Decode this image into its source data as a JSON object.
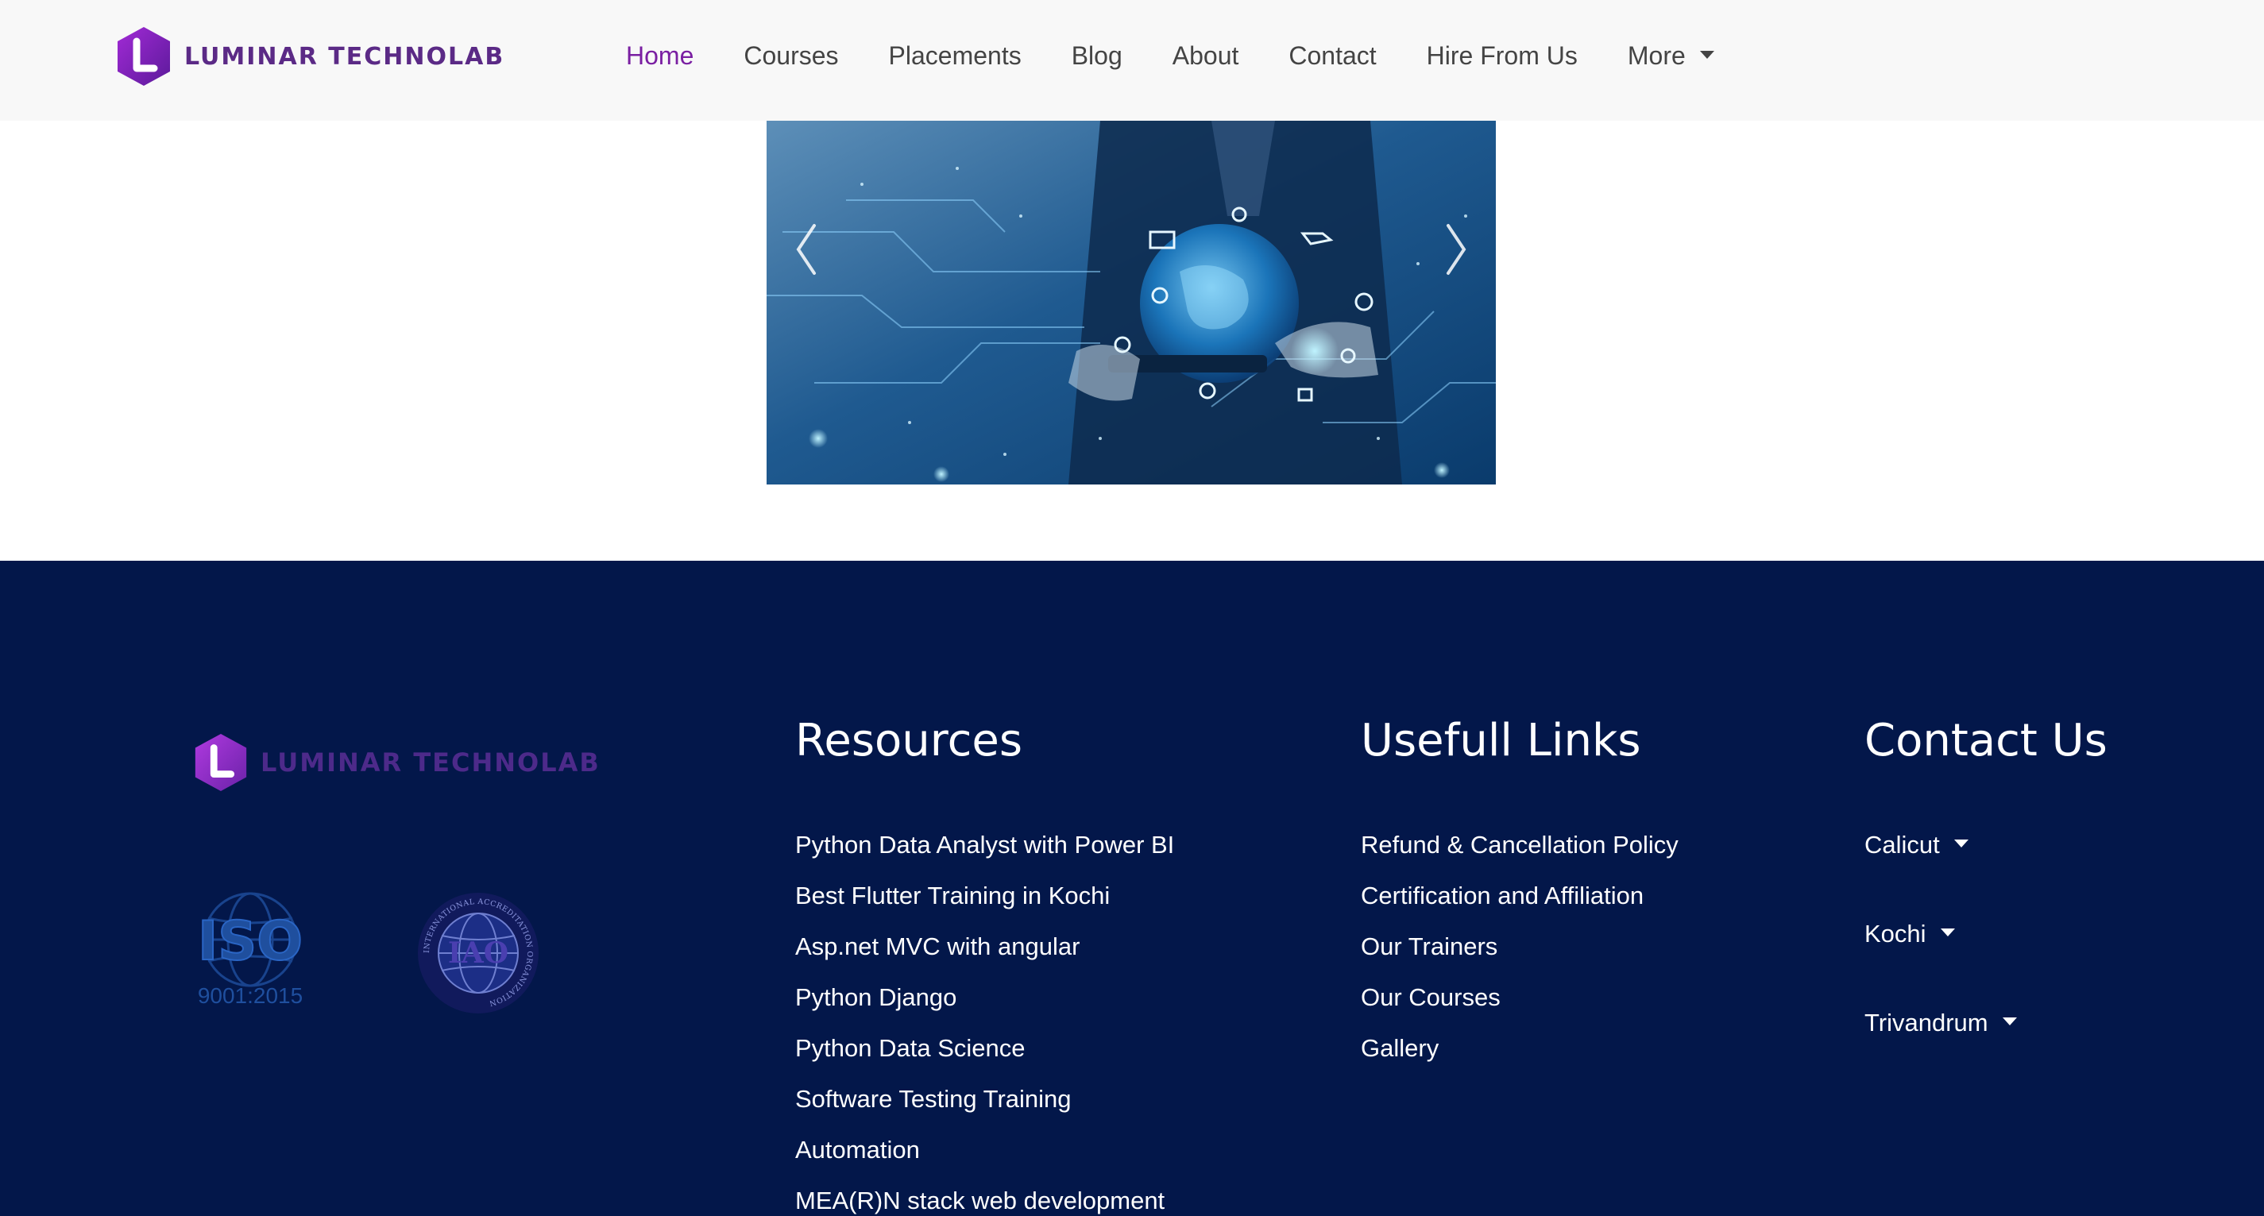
{
  "brand": {
    "name": "LUMINAR TECHNOLAB",
    "icon": "luminar-logo-icon",
    "color": "#5b2a86"
  },
  "nav": {
    "items": [
      {
        "label": "Home",
        "active": true
      },
      {
        "label": "Courses"
      },
      {
        "label": "Placements"
      },
      {
        "label": "Blog"
      },
      {
        "label": "About"
      },
      {
        "label": "Contact"
      },
      {
        "label": "Hire From Us"
      },
      {
        "label": "More",
        "dropdown": true
      }
    ],
    "active_color": "#7a1fa2"
  },
  "carousel": {
    "prev_icon": "chevron-left-icon",
    "next_icon": "chevron-right-icon"
  },
  "footer": {
    "background": "#03174a",
    "logo_text": "LUMINAR TECHNOLAB",
    "certifications": {
      "iso_label": "ISO",
      "iso_number": "9001:2015",
      "iao_label": "IAO",
      "iao_ring": "INTERNATIONAL ACCREDITATION ORGANIZATION"
    },
    "resources": {
      "title": "Resources",
      "links": [
        "Python Data Analyst with Power BI",
        "Best Flutter Training in Kochi",
        "Asp.net MVC with angular",
        "Python Django",
        "Python Data Science",
        "Software Testing Training",
        "Automation",
        "MEA(R)N stack web development"
      ]
    },
    "useful_links": {
      "title": "Usefull Links",
      "links": [
        "Refund & Cancellation Policy",
        "Certification and Affiliation",
        "Our Trainers",
        "Our Courses",
        "Gallery"
      ]
    },
    "contact": {
      "title": "Contact Us",
      "locations": [
        "Calicut",
        "Kochi",
        "Trivandrum"
      ]
    }
  }
}
